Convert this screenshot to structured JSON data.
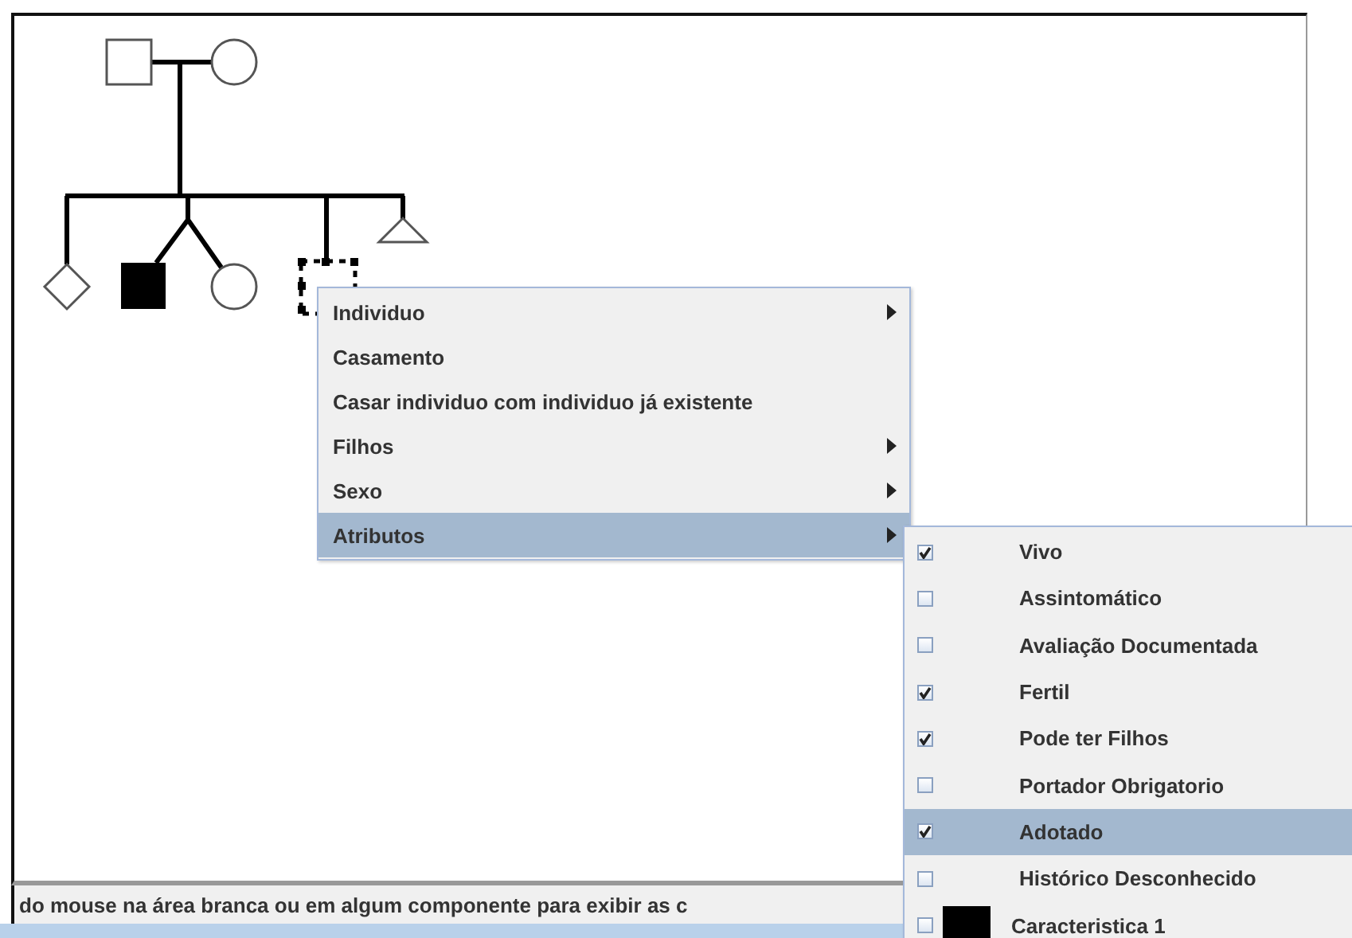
{
  "context_menu": {
    "items": [
      {
        "label": "Individuo",
        "has_submenu": true,
        "selected": false
      },
      {
        "label": "Casamento",
        "has_submenu": false,
        "selected": false
      },
      {
        "label": "Casar individuo com individuo já existente",
        "has_submenu": false,
        "selected": false
      },
      {
        "label": "Filhos",
        "has_submenu": true,
        "selected": false
      },
      {
        "label": "Sexo",
        "has_submenu": true,
        "selected": false
      },
      {
        "label": "Atributos",
        "has_submenu": true,
        "selected": true
      }
    ]
  },
  "submenu": {
    "items": [
      {
        "kind": "check",
        "label": "Vivo",
        "checked": true,
        "selected": false
      },
      {
        "kind": "check",
        "label": "Assintomático",
        "checked": false,
        "selected": false
      },
      {
        "kind": "check",
        "label": "Avaliação Documentada",
        "checked": false,
        "selected": false
      },
      {
        "kind": "check",
        "label": "Fertil",
        "checked": true,
        "selected": false
      },
      {
        "kind": "check",
        "label": "Pode ter Filhos",
        "checked": true,
        "selected": false
      },
      {
        "kind": "check",
        "label": "Portador Obrigatorio",
        "checked": false,
        "selected": false
      },
      {
        "kind": "check",
        "label": "Adotado",
        "checked": true,
        "selected": true
      },
      {
        "kind": "check",
        "label": "Histórico Desconhecido",
        "checked": false,
        "selected": false
      },
      {
        "kind": "trait",
        "label": "Caracteristica 1",
        "checked": false,
        "selected": false,
        "color": "#000000"
      }
    ]
  },
  "status_bar": {
    "text": "do mouse na área branca ou em algum componente para exibir as c"
  }
}
